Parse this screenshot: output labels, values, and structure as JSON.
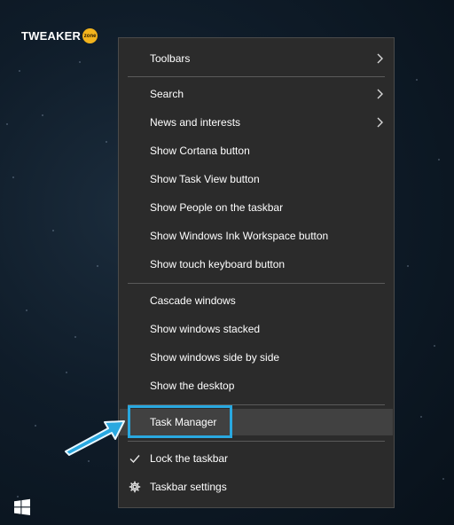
{
  "brand": {
    "logo_text": "TWEAKER",
    "logo_badge": "zone"
  },
  "colors": {
    "menu_bg": "#2b2b2b",
    "menu_hover": "#414141",
    "highlight_border": "#29a8e0",
    "arrow": "#29a8e0"
  },
  "menu": {
    "items": [
      {
        "label": "Toolbars",
        "submenu": true
      },
      {
        "label": "Search",
        "submenu": true
      },
      {
        "label": "News and interests",
        "submenu": true
      },
      {
        "label": "Show Cortana button"
      },
      {
        "label": "Show Task View button"
      },
      {
        "label": "Show People on the taskbar"
      },
      {
        "label": "Show Windows Ink Workspace button"
      },
      {
        "label": "Show touch keyboard button"
      },
      {
        "label": "Cascade windows"
      },
      {
        "label": "Show windows stacked"
      },
      {
        "label": "Show windows side by side"
      },
      {
        "label": "Show the desktop"
      },
      {
        "label": "Task Manager",
        "highlighted": true
      },
      {
        "label": "Lock the taskbar",
        "icon": "checkmark-icon",
        "checked": true
      },
      {
        "label": "Taskbar settings",
        "icon": "gear-icon"
      }
    ]
  },
  "taskbar": {
    "start_icon": "windows-logo-icon"
  }
}
